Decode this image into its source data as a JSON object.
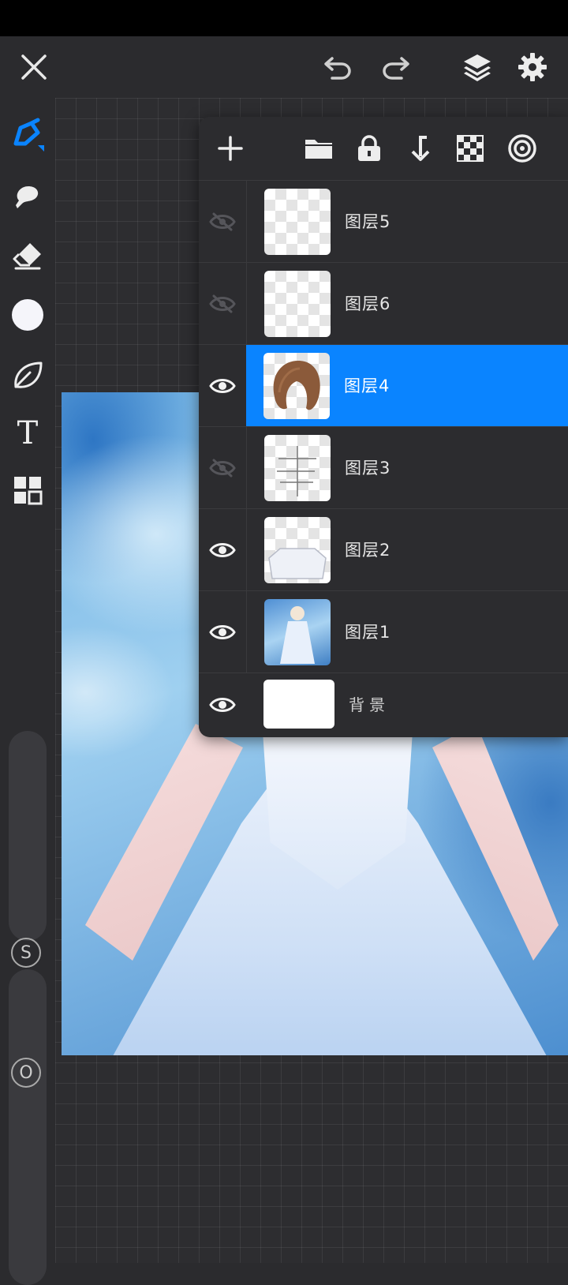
{
  "topbar": {
    "close_icon": "close-icon",
    "undo_icon": "undo-icon",
    "redo_icon": "redo-icon",
    "layers_icon": "layers-icon",
    "settings_icon": "gear-icon"
  },
  "tools": [
    {
      "name": "brush",
      "icon": "pen-icon",
      "selected": true
    },
    {
      "name": "smudge",
      "icon": "smudge-icon"
    },
    {
      "name": "eraser",
      "icon": "eraser-icon"
    },
    {
      "name": "color",
      "icon": "color-swatch",
      "color": "#f5f5fa"
    },
    {
      "name": "selection",
      "icon": "leaf-selection-icon"
    },
    {
      "name": "text",
      "icon": "text-icon",
      "label": "T"
    },
    {
      "name": "more",
      "icon": "grid-icon"
    }
  ],
  "sliders": {
    "size_label": "S",
    "opacity_label": "O"
  },
  "layers_toolbar": [
    "add-layer-icon",
    "folder-icon",
    "lock-icon",
    "merge-down-icon",
    "checker-icon",
    "blend-mode-icon"
  ],
  "layers": [
    {
      "name": "图层5",
      "visible": false,
      "selected": false
    },
    {
      "name": "图层6",
      "visible": false,
      "selected": false
    },
    {
      "name": "图层4",
      "visible": true,
      "selected": true
    },
    {
      "name": "图层3",
      "visible": false,
      "selected": false
    },
    {
      "name": "图层2",
      "visible": true,
      "selected": false
    },
    {
      "name": "图层1",
      "visible": true,
      "selected": false
    }
  ],
  "background_layer": {
    "name": "背景",
    "visible": true
  },
  "colors": {
    "accent": "#0a84ff",
    "panel": "#2c2c2f",
    "toolbar": "#2b2b2e"
  }
}
